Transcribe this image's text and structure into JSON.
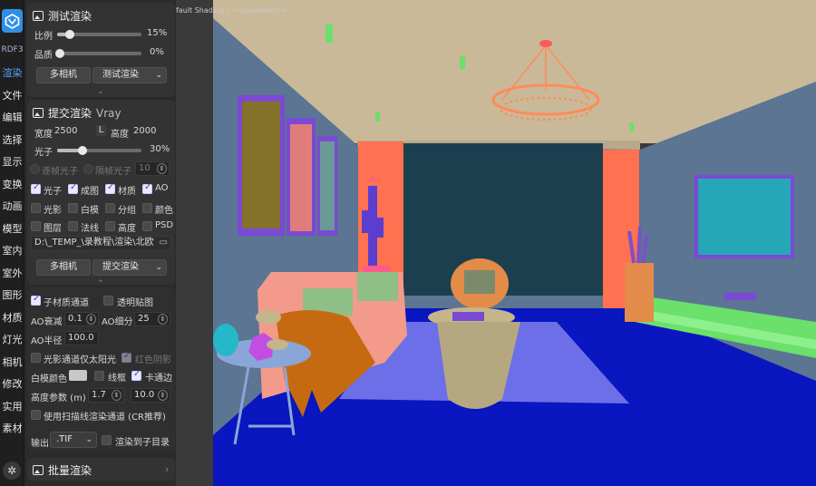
{
  "app": {
    "logo_text": "RDF3"
  },
  "sidebar": {
    "items": [
      {
        "label": "渲染",
        "active": true
      },
      {
        "label": "文件"
      },
      {
        "label": "编辑"
      },
      {
        "label": "选择"
      },
      {
        "label": "显示"
      },
      {
        "label": "变换"
      },
      {
        "label": "动画"
      },
      {
        "label": "模型"
      },
      {
        "label": "室内"
      },
      {
        "label": "室外"
      },
      {
        "label": "图形"
      },
      {
        "label": "材质"
      },
      {
        "label": "灯光"
      },
      {
        "label": "相机"
      },
      {
        "label": "修改"
      },
      {
        "label": "实用"
      },
      {
        "label": "素材"
      }
    ]
  },
  "test_render": {
    "title": "测试渲染",
    "ratio_label": "比例",
    "ratio_value": "15%",
    "ratio": 0.15,
    "quality_label": "品质",
    "quality_value": "0%",
    "quality": 0.0,
    "multicam_label": "多相机",
    "render_select": "测试渲染"
  },
  "submit_render": {
    "title": "提交渲染",
    "renderer": "Vray",
    "width_label": "宽度",
    "width": "2500",
    "lock_label": "L",
    "height_label": "高度",
    "height": "2000",
    "photon_label": "光子",
    "photon_value": "30%",
    "photon": 0.3,
    "per_frame_label": "逐帧光子",
    "interval_label": "隔帧光子",
    "interval_value": "10",
    "checks_row1": [
      {
        "label": "光子",
        "checked": true
      },
      {
        "label": "成图",
        "checked": true
      },
      {
        "label": "材质",
        "checked": true
      },
      {
        "label": "AO",
        "checked": true
      }
    ],
    "checks_row2": [
      {
        "label": "光影",
        "checked": false
      },
      {
        "label": "白模",
        "checked": false
      },
      {
        "label": "分组",
        "checked": false
      },
      {
        "label": "颜色",
        "checked": false
      }
    ],
    "checks_row3": [
      {
        "label": "图层",
        "checked": false
      },
      {
        "label": "法线",
        "checked": false
      },
      {
        "label": "高度",
        "checked": false
      },
      {
        "label": "PSD",
        "checked": false
      }
    ],
    "path": "D:\\_TEMP_\\录教程\\渲染\\北欧",
    "multicam_label": "多相机",
    "submit_select": "提交渲染"
  },
  "options": {
    "sub_material_label": "子材质通道",
    "sub_material": true,
    "transparent_label": "透明贴图",
    "transparent": false,
    "ao_falloff_label": "AO衰减",
    "ao_falloff": "0.1",
    "ao_subdiv_label": "AO细分",
    "ao_subdiv": "25",
    "ao_radius_label": "AO半径",
    "ao_radius": "100.0",
    "sun_only_label": "光影通道仅太阳光",
    "sun_only": false,
    "red_shadow_label": "红色阴影",
    "red_shadow": true,
    "white_color_label": "白模颜色",
    "wireframe_label": "线框",
    "wireframe": false,
    "cartoon_label": "卡通边",
    "cartoon": true,
    "height_param_label": "高度参数 (m)",
    "height_min": "1.7",
    "height_max": "10.0",
    "scanline_label": "使用扫描线渲染通道 (CR推荐)",
    "scanline": false,
    "output_label": "输出",
    "output_format": ".TIF",
    "to_subdir_label": "渲染到子目录",
    "to_subdir": false
  },
  "batch_render": {
    "title": "批量渲染"
  },
  "viewport": {
    "label": "fault Shading ]  <<Disabled>>"
  }
}
